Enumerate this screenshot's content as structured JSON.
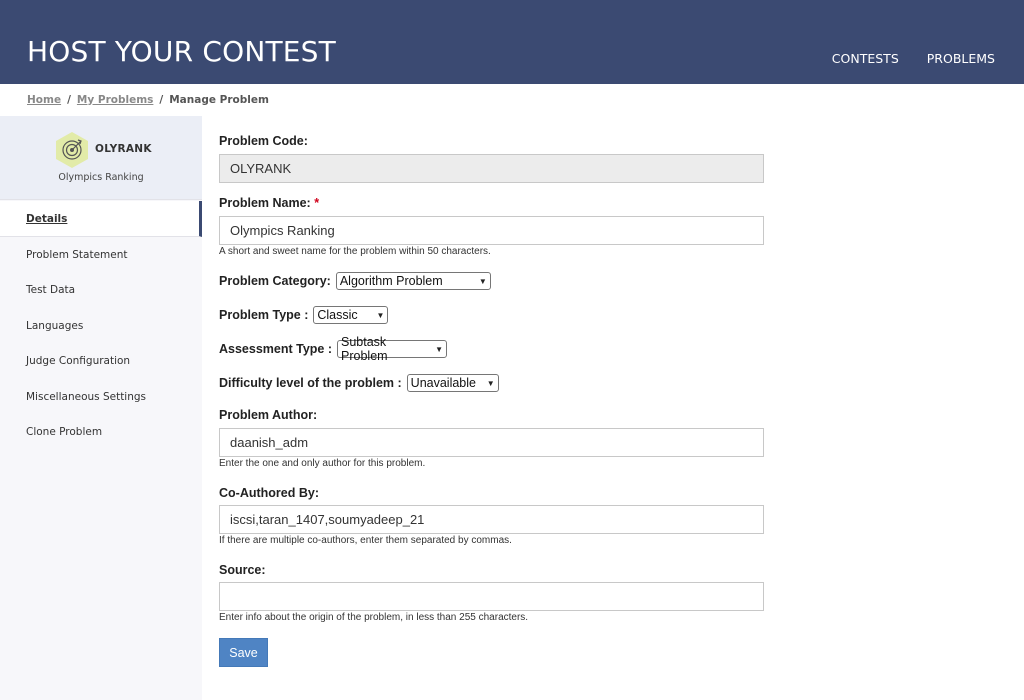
{
  "header": {
    "brand": "HOST YOUR CONTEST",
    "nav": [
      "CONTESTS",
      "PROBLEMS"
    ]
  },
  "breadcrumb": {
    "home": "Home",
    "my_problems": "My Problems",
    "current": "Manage Problem",
    "separator": "/"
  },
  "sidebar": {
    "code": "OLYRANK",
    "name": "Olympics Ranking",
    "items": [
      {
        "label": "Details",
        "active": true
      },
      {
        "label": "Problem Statement"
      },
      {
        "label": "Test Data"
      },
      {
        "label": "Languages"
      },
      {
        "label": "Judge Configuration"
      },
      {
        "label": "Miscellaneous Settings"
      },
      {
        "label": "Clone Problem"
      }
    ]
  },
  "form": {
    "problem_code_label": "Problem Code:",
    "problem_code_value": "OLYRANK",
    "problem_name_label": "Problem Name:",
    "required_mark": "*",
    "problem_name_value": "Olympics Ranking",
    "problem_name_hint": "A short and sweet name for the problem within 50 characters.",
    "category_label": "Problem Category:",
    "category_value": "Algorithm Problem",
    "type_label": "Problem Type :",
    "type_value": "Classic",
    "assessment_label": "Assessment Type :",
    "assessment_value": "Subtask Problem",
    "difficulty_label": "Difficulty level of the problem :",
    "difficulty_value": "Unavailable",
    "author_label": "Problem Author:",
    "author_value": "daanish_adm",
    "author_hint": "Enter the one and only author for this problem.",
    "coauthor_label": "Co-Authored By:",
    "coauthor_value": "iscsi,taran_1407,soumyadeep_21",
    "coauthor_hint": "If there are multiple co-authors, enter them separated by commas.",
    "source_label": "Source:",
    "source_value": "",
    "source_hint": "Enter info about the origin of the problem, in less than 255 characters.",
    "save_label": "Save"
  },
  "colors": {
    "header_bg": "#3b4a72",
    "save_button": "#4f84c4",
    "sidebar_bg": "#f7f7fa",
    "required": "#d0021b"
  }
}
